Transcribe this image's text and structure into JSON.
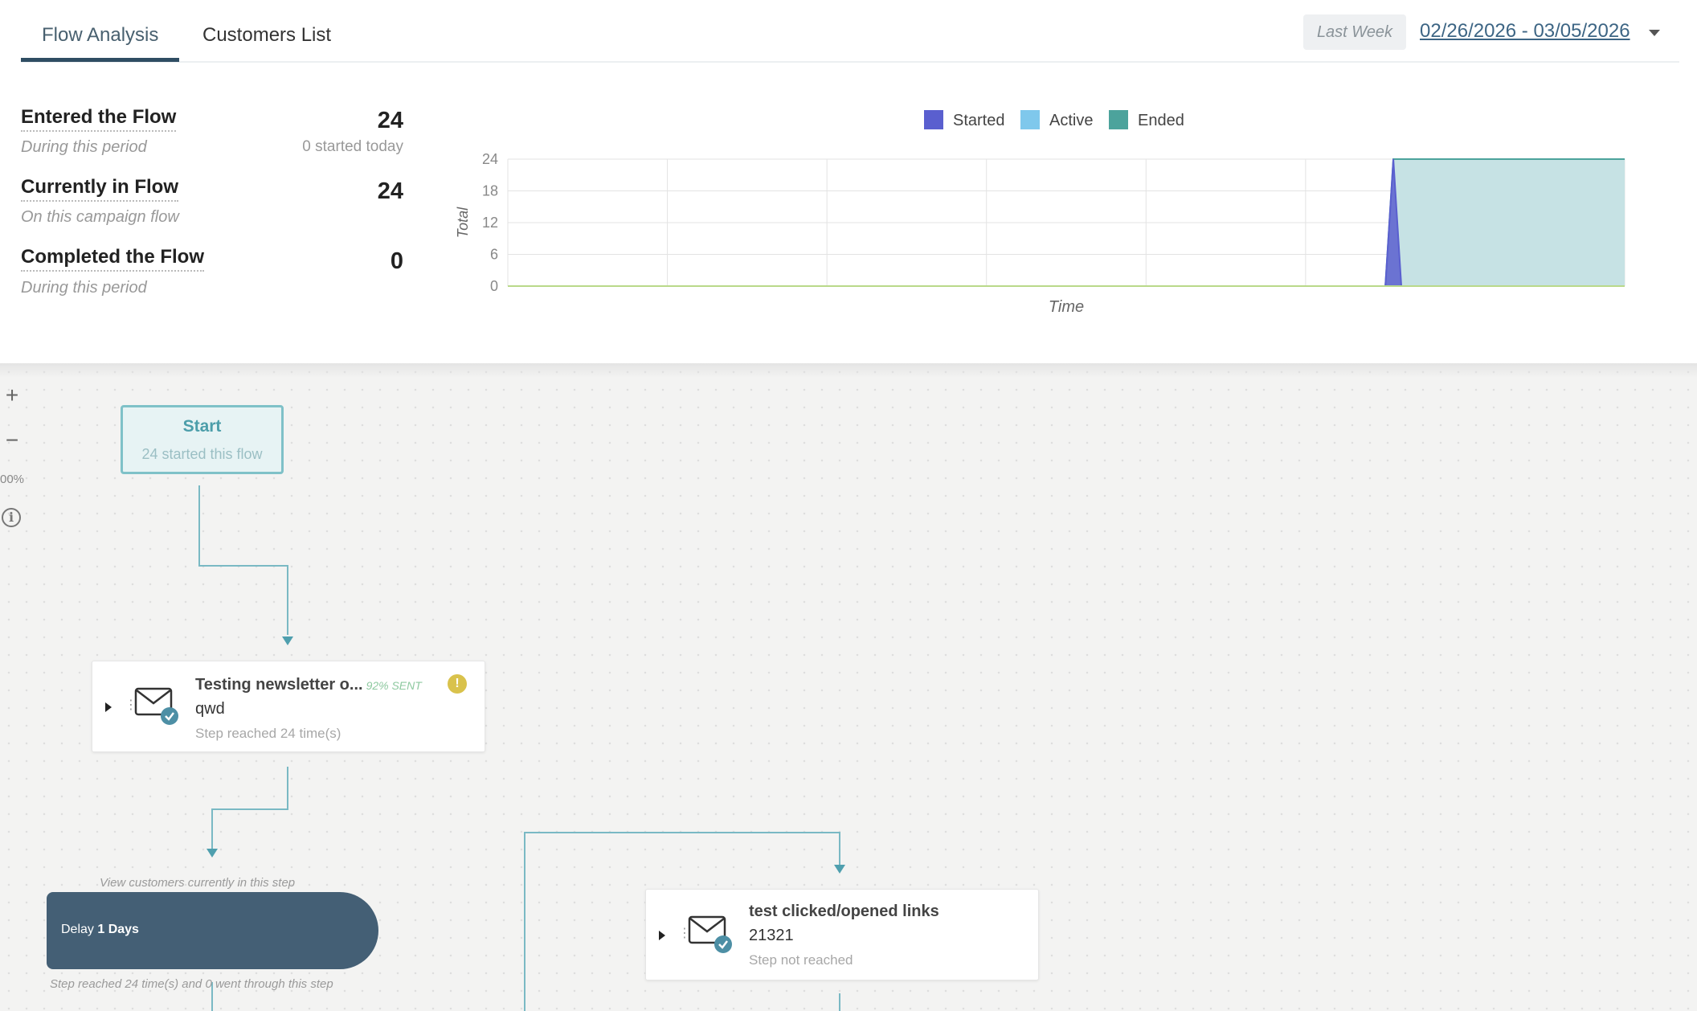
{
  "tabs": [
    {
      "label": "Flow Analysis",
      "active": true
    },
    {
      "label": "Customers List",
      "active": false
    }
  ],
  "date_range": {
    "preset": "Last Week",
    "value": "02/26/2026 - 03/05/2026"
  },
  "stats": [
    {
      "title": "Entered the Flow",
      "subtitle": "During this period",
      "value": "24",
      "note": "0 started today"
    },
    {
      "title": "Currently in Flow",
      "subtitle": "On this campaign flow",
      "value": "24",
      "note": ""
    },
    {
      "title": "Completed the Flow",
      "subtitle": "During this period",
      "value": "0",
      "note": ""
    }
  ],
  "chart_data": {
    "type": "area",
    "title": "",
    "xlabel": "Time",
    "ylabel": "Total",
    "ylim": [
      0,
      24
    ],
    "yticks": [
      0,
      6,
      12,
      18,
      24
    ],
    "x": [
      0,
      5.5,
      5.55,
      5.6,
      7
    ],
    "grid": true,
    "legend": "top-center",
    "series": [
      {
        "name": "Started",
        "color": "#5a5fcf",
        "values": [
          0,
          0,
          24,
          0,
          0
        ]
      },
      {
        "name": "Active",
        "color": "#7fc8ec",
        "values": [
          0,
          0,
          24,
          24,
          24
        ]
      },
      {
        "name": "Ended",
        "color": "#4ca39c",
        "values": [
          0,
          0,
          0,
          0,
          0
        ]
      }
    ]
  },
  "canvas": {
    "zoom_in": "+",
    "zoom_out": "−",
    "zoom_level": "00%",
    "start_node": {
      "title": "Start",
      "subtitle": "24 started this flow"
    },
    "email_step_1": {
      "title": "Testing newsletter o...",
      "sent_pct": "92% SENT",
      "warning": "!",
      "subject": "qwd",
      "note": "Step reached 24 time(s)"
    },
    "delay_step": {
      "hint": "View customers currently in this step",
      "label_prefix": "Delay ",
      "label_bold": "1 Days",
      "note": "Step reached 24 time(s) and 0 went through this step"
    },
    "email_step_2": {
      "title": "test clicked/opened links",
      "subject": "21321",
      "note": "Step not reached"
    }
  },
  "colors": {
    "accent": "#2f4d63",
    "wire": "#6db3bf",
    "delay": "#445f75"
  }
}
